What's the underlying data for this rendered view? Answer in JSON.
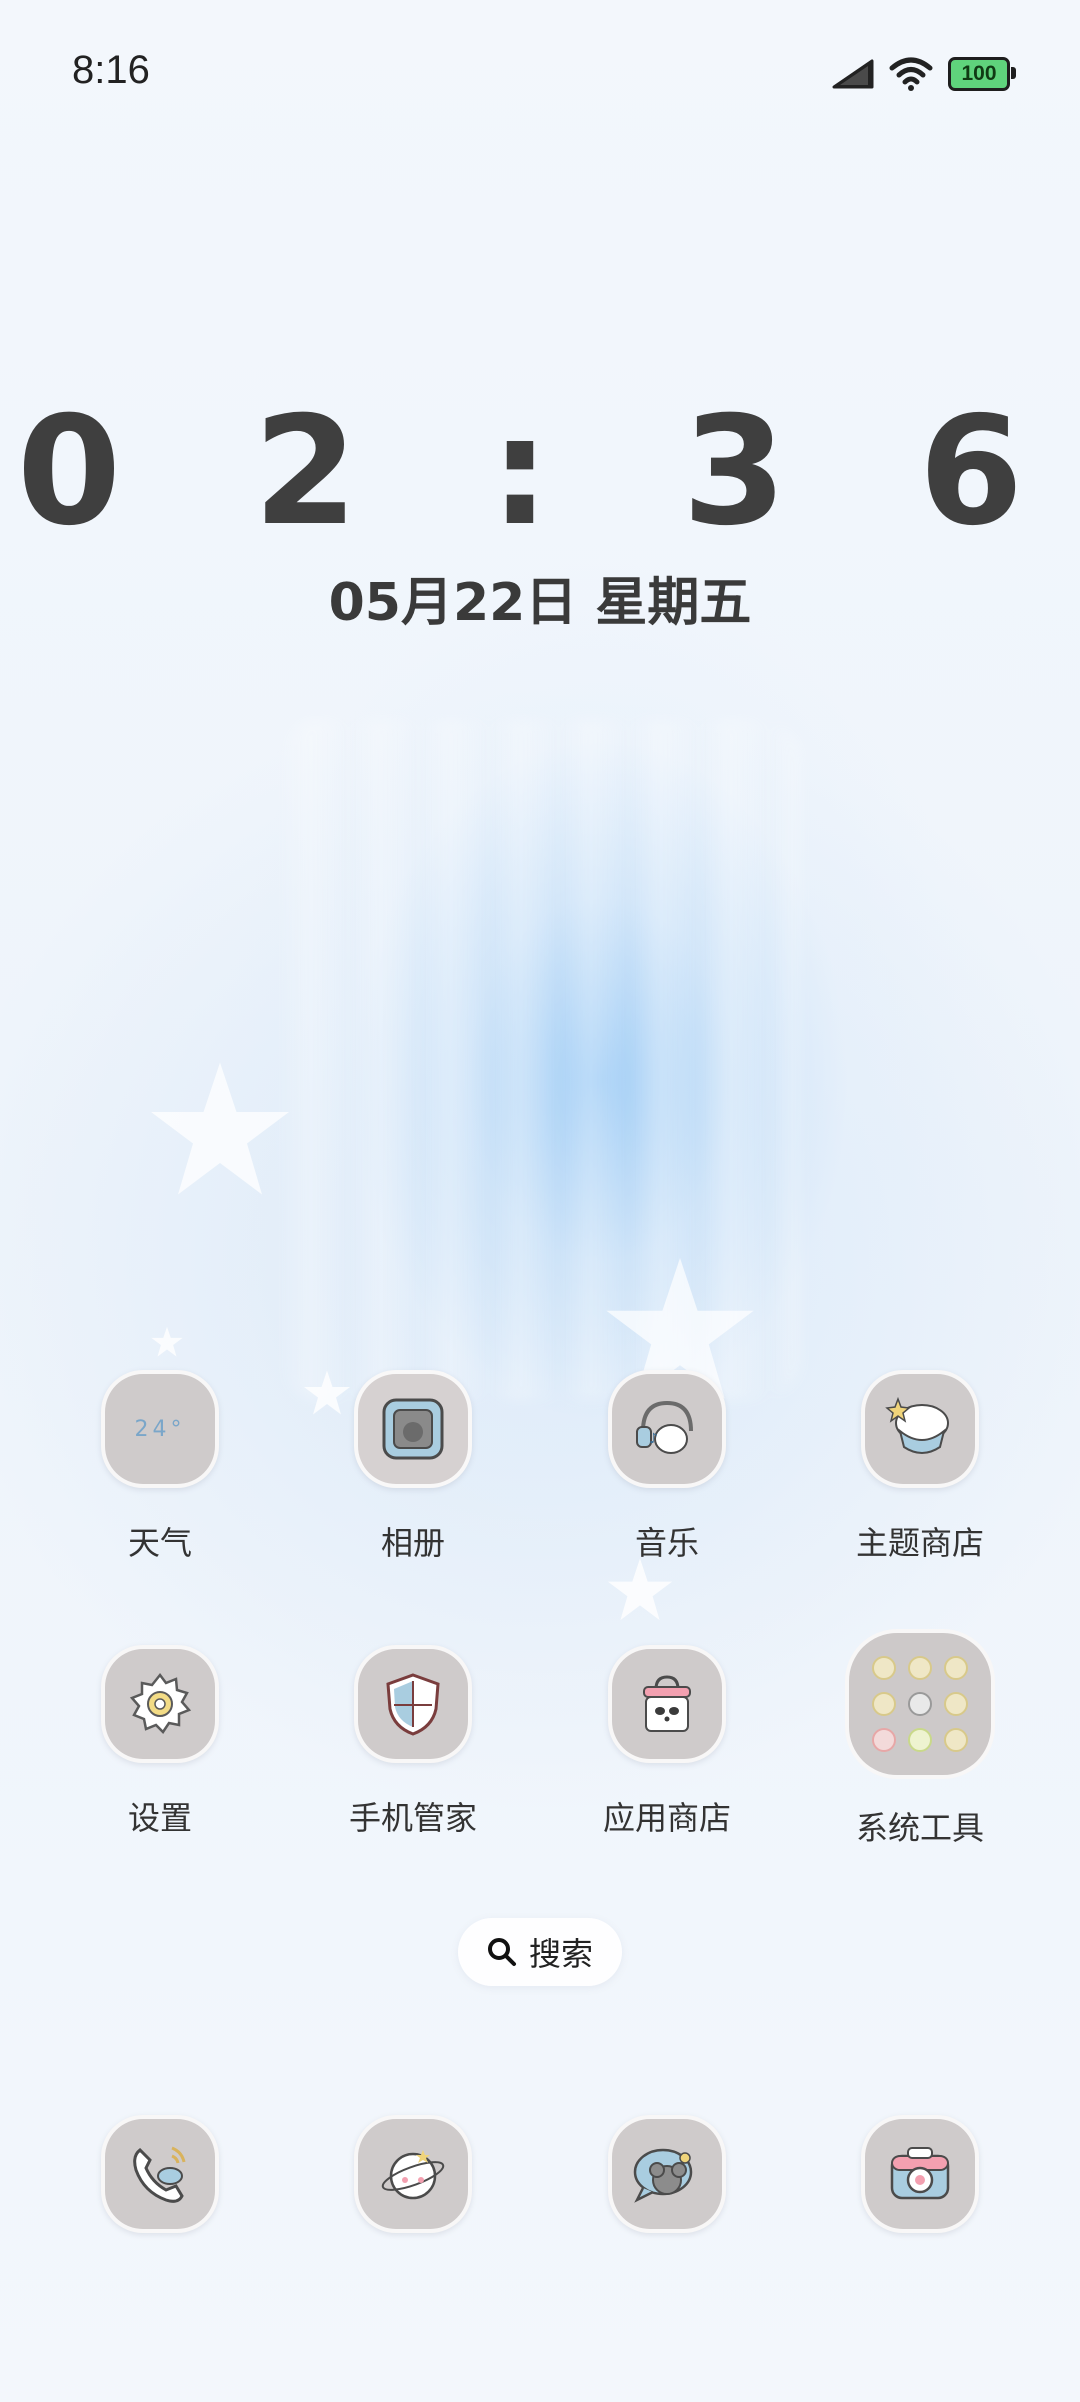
{
  "status_bar": {
    "time": "8:16",
    "battery": "100"
  },
  "clock_widget": {
    "time": "0 2 : 3 6",
    "date": "05月22日 星期五"
  },
  "apps": [
    {
      "label": "天气",
      "icon": "weather-icon",
      "icon_text": "24°"
    },
    {
      "label": "相册",
      "icon": "gallery-icon"
    },
    {
      "label": "音乐",
      "icon": "music-icon"
    },
    {
      "label": "主题商店",
      "icon": "theme-store-icon"
    },
    {
      "label": "设置",
      "icon": "settings-gear-icon"
    },
    {
      "label": "手机管家",
      "icon": "phone-manager-shield-icon"
    },
    {
      "label": "应用商店",
      "icon": "app-store-bag-icon"
    },
    {
      "label": "系统工具",
      "icon": "system-tools-folder-icon"
    }
  ],
  "search": {
    "label": "搜索"
  },
  "dock": [
    {
      "icon": "phone-icon"
    },
    {
      "icon": "browser-icon"
    },
    {
      "icon": "messages-icon"
    },
    {
      "icon": "camera-icon"
    }
  ],
  "colors": {
    "background": "#f1f6fc",
    "icon_bg": "#cfcbcb",
    "text": "#333333",
    "clock": "#3f3f3f",
    "battery_fill": "#5fd37c"
  }
}
